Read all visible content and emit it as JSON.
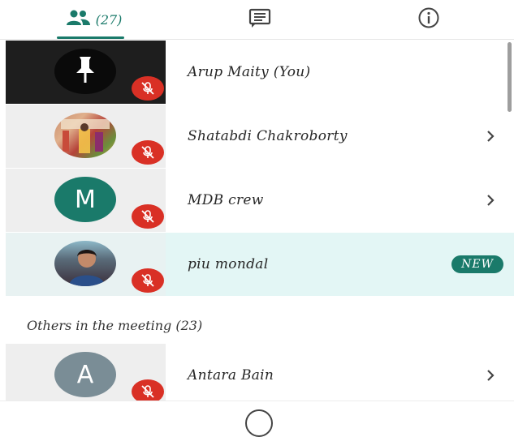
{
  "tabs": [
    {
      "name": "people",
      "icon": "people-icon",
      "count": "(27)",
      "active": true
    },
    {
      "name": "chat",
      "icon": "chat-icon"
    },
    {
      "name": "info",
      "icon": "info-icon"
    }
  ],
  "participants": [
    {
      "name": "Arup Maity (You)",
      "avatar": "pin-icon",
      "muted": true
    },
    {
      "name": "Shatabdi Chakroborty",
      "avatar": "photo",
      "muted": true
    },
    {
      "name": "MDB crew",
      "avatar_letter": "M",
      "avatar_color": "#1a7a6a",
      "muted": true
    },
    {
      "name": "piu mondal",
      "avatar": "photo",
      "muted": true,
      "badge": "NEW"
    }
  ],
  "others_header": "Others in the meeting (23)",
  "others": [
    {
      "name": "Antara Bain",
      "avatar_letter": "A",
      "avatar_color": "#7a8d96",
      "muted": true
    }
  ],
  "colors": {
    "accent": "#1a7a6a",
    "mute": "#d93025",
    "highlight": "#e3f6f5"
  }
}
